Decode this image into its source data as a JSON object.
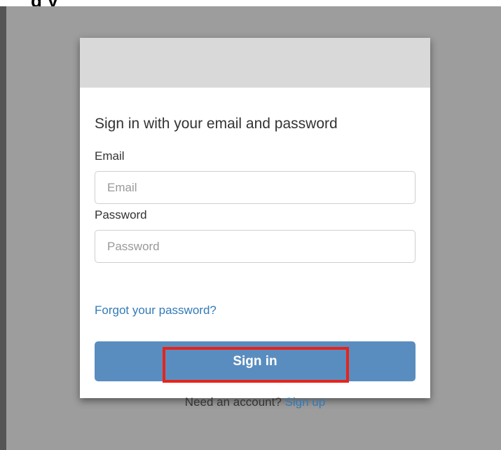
{
  "header_fragment": "g                           y",
  "card": {
    "heading": "Sign in with your email and password",
    "email_label": "Email",
    "email_placeholder": "Email",
    "email_value": "",
    "password_label": "Password",
    "password_placeholder": "Password",
    "password_value": "",
    "forgot_link": "Forgot your password?",
    "signin_button": "Sign in",
    "signup_prompt": "Need an account?",
    "signup_link": "Sign up"
  },
  "colors": {
    "backdrop": "#9d9d9d",
    "button": "#5a8dbf",
    "link": "#337ab7",
    "highlight": "#e8231a"
  }
}
